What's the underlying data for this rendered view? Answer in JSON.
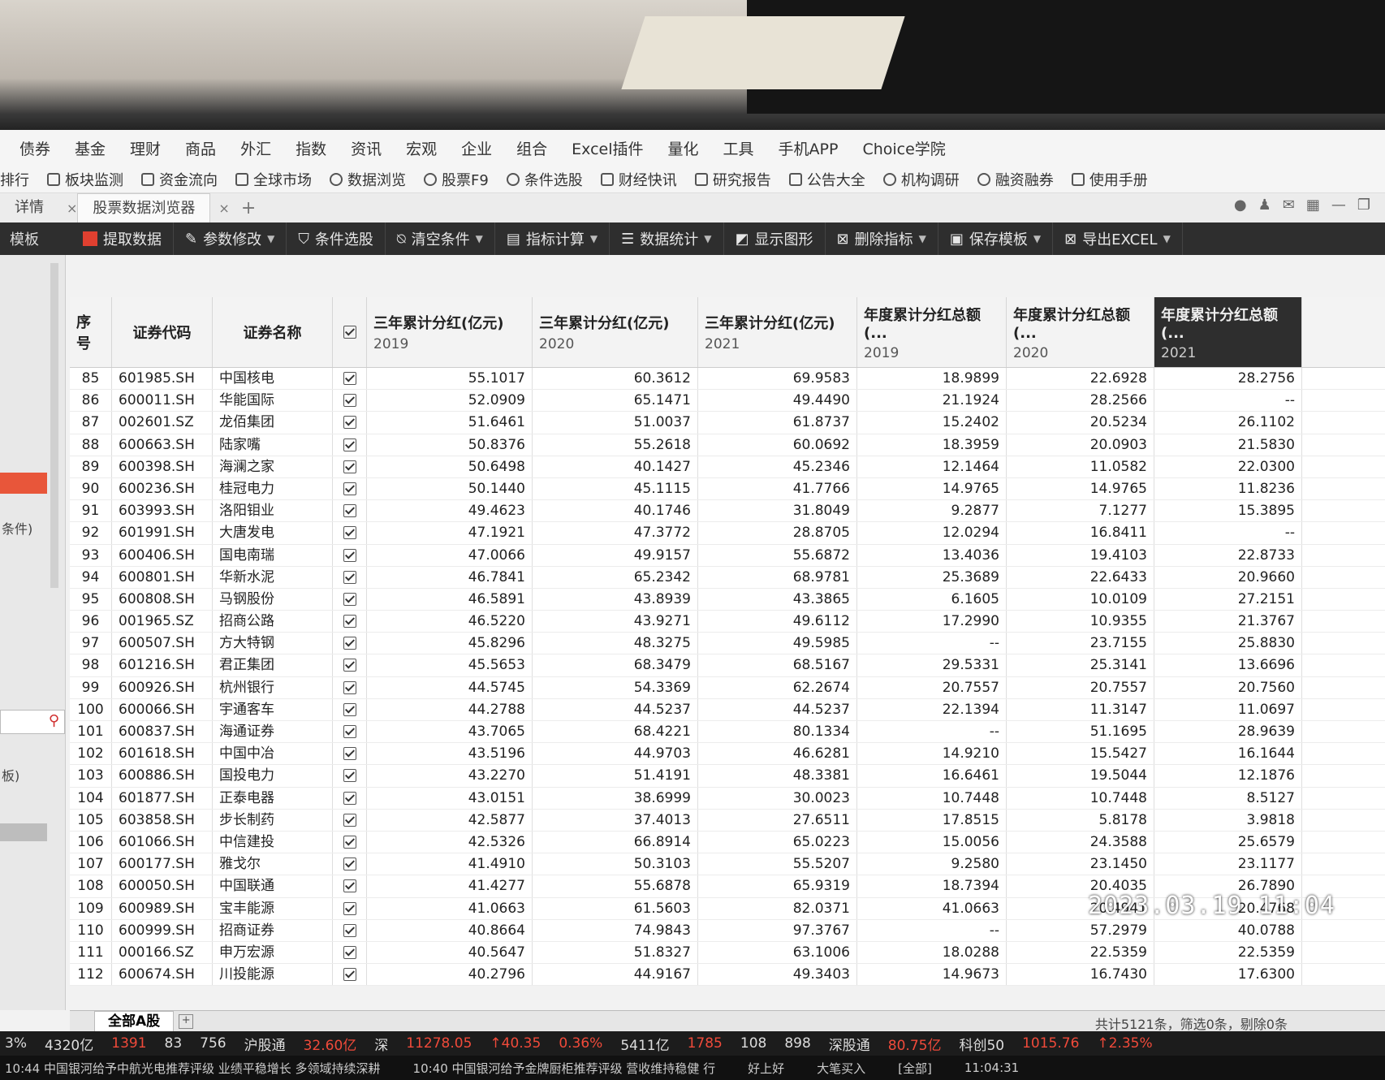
{
  "menu": [
    "债券",
    "基金",
    "理财",
    "商品",
    "外汇",
    "指数",
    "资讯",
    "宏观",
    "企业",
    "组合",
    "Excel插件",
    "量化",
    "工具",
    "手机APP",
    "Choice学院"
  ],
  "toolbar": [
    "排行",
    "板块监测",
    "资金流向",
    "全球市场",
    "数据浏览",
    "股票F9",
    "条件选股",
    "财经快讯",
    "研究报告",
    "公告大全",
    "机构调研",
    "融资融券",
    "使用手册"
  ],
  "tabs": {
    "left": "详情",
    "active": "股票数据浏览器"
  },
  "actions": {
    "left_label": "模板",
    "extract": "提取数据",
    "params": "参数修改",
    "filter": "条件选股",
    "clear": "清空条件",
    "calc": "指标计算",
    "stats": "数据统计",
    "chart": "显示图形",
    "delete": "删除指标",
    "save": "保存模板",
    "export": "导出EXCEL"
  },
  "sidebar": {
    "label1": "条件)",
    "label2": "板)"
  },
  "columns": {
    "seq": "序号",
    "code": "证券代码",
    "name": "证券名称",
    "c1": {
      "title": "三年累计分红(亿元)",
      "year": "2019"
    },
    "c2": {
      "title": "三年累计分红(亿元)",
      "year": "2020"
    },
    "c3": {
      "title": "三年累计分红(亿元)",
      "year": "2021"
    },
    "c4": {
      "title": "年度累计分红总额(...",
      "year": "2019"
    },
    "c5": {
      "title": "年度累计分红总额(...",
      "year": "2020"
    },
    "c6": {
      "title": "年度累计分红总额(...",
      "year": "2021"
    }
  },
  "rows": [
    [
      "85",
      "601985.SH",
      "中国核电",
      "55.1017",
      "60.3612",
      "69.9583",
      "18.9899",
      "22.6928",
      "28.2756"
    ],
    [
      "86",
      "600011.SH",
      "华能国际",
      "52.0909",
      "65.1471",
      "49.4490",
      "21.1924",
      "28.2566",
      "--"
    ],
    [
      "87",
      "002601.SZ",
      "龙佰集团",
      "51.6461",
      "51.0037",
      "61.8737",
      "15.2402",
      "20.5234",
      "26.1102"
    ],
    [
      "88",
      "600663.SH",
      "陆家嘴",
      "50.8376",
      "55.2618",
      "60.0692",
      "18.3959",
      "20.0903",
      "21.5830"
    ],
    [
      "89",
      "600398.SH",
      "海澜之家",
      "50.6498",
      "40.1427",
      "45.2346",
      "12.1464",
      "11.0582",
      "22.0300"
    ],
    [
      "90",
      "600236.SH",
      "桂冠电力",
      "50.1440",
      "45.1115",
      "41.7766",
      "14.9765",
      "14.9765",
      "11.8236"
    ],
    [
      "91",
      "603993.SH",
      "洛阳钼业",
      "49.4623",
      "40.1746",
      "31.8049",
      "9.2877",
      "7.1277",
      "15.3895"
    ],
    [
      "92",
      "601991.SH",
      "大唐发电",
      "47.1921",
      "47.3772",
      "28.8705",
      "12.0294",
      "16.8411",
      "--"
    ],
    [
      "93",
      "600406.SH",
      "国电南瑞",
      "47.0066",
      "49.9157",
      "55.6872",
      "13.4036",
      "19.4103",
      "22.8733"
    ],
    [
      "94",
      "600801.SH",
      "华新水泥",
      "46.7841",
      "65.2342",
      "68.9781",
      "25.3689",
      "22.6433",
      "20.9660"
    ],
    [
      "95",
      "600808.SH",
      "马钢股份",
      "46.5891",
      "43.8939",
      "43.3865",
      "6.1605",
      "10.0109",
      "27.2151"
    ],
    [
      "96",
      "001965.SZ",
      "招商公路",
      "46.5220",
      "43.9271",
      "49.6112",
      "17.2990",
      "10.9355",
      "21.3767"
    ],
    [
      "97",
      "600507.SH",
      "方大特钢",
      "45.8296",
      "48.3275",
      "49.5985",
      "--",
      "23.7155",
      "25.8830"
    ],
    [
      "98",
      "601216.SH",
      "君正集团",
      "45.5653",
      "68.3479",
      "68.5167",
      "29.5331",
      "25.3141",
      "13.6696"
    ],
    [
      "99",
      "600926.SH",
      "杭州银行",
      "44.5745",
      "54.3369",
      "62.2674",
      "20.7557",
      "20.7557",
      "20.7560"
    ],
    [
      "100",
      "600066.SH",
      "宇通客车",
      "44.2788",
      "44.5237",
      "44.5237",
      "22.1394",
      "11.3147",
      "11.0697"
    ],
    [
      "101",
      "600837.SH",
      "海通证券",
      "43.7065",
      "68.4221",
      "80.1334",
      "--",
      "51.1695",
      "28.9639"
    ],
    [
      "102",
      "601618.SH",
      "中国中冶",
      "43.5196",
      "44.9703",
      "46.6281",
      "14.9210",
      "15.5427",
      "16.1644"
    ],
    [
      "103",
      "600886.SH",
      "国投电力",
      "43.2270",
      "51.4191",
      "48.3381",
      "16.6461",
      "19.5044",
      "12.1876"
    ],
    [
      "104",
      "601877.SH",
      "正泰电器",
      "43.0151",
      "38.6999",
      "30.0023",
      "10.7448",
      "10.7448",
      "8.5127"
    ],
    [
      "105",
      "603858.SH",
      "步长制药",
      "42.5877",
      "37.4013",
      "27.6511",
      "17.8515",
      "5.8178",
      "3.9818"
    ],
    [
      "106",
      "601066.SH",
      "中信建投",
      "42.5326",
      "66.8914",
      "65.0223",
      "15.0056",
      "24.3588",
      "25.6579"
    ],
    [
      "107",
      "600177.SH",
      "雅戈尔",
      "41.4910",
      "50.3103",
      "55.5207",
      "9.2580",
      "23.1450",
      "23.1177"
    ],
    [
      "108",
      "600050.SH",
      "中国联通",
      "41.4277",
      "55.6878",
      "65.9319",
      "18.7394",
      "20.4035",
      "26.7890"
    ],
    [
      "109",
      "600989.SH",
      "宝丰能源",
      "41.0663",
      "61.5603",
      "82.0371",
      "41.0663",
      "20.4941",
      "20.4768"
    ],
    [
      "110",
      "600999.SH",
      "招商证券",
      "40.8664",
      "74.9843",
      "97.3767",
      "--",
      "57.2979",
      "40.0788"
    ],
    [
      "111",
      "000166.SZ",
      "申万宏源",
      "40.5647",
      "51.8327",
      "63.1006",
      "18.0288",
      "22.5359",
      "22.5359"
    ],
    [
      "112",
      "600674.SH",
      "川投能源",
      "40.2796",
      "44.9167",
      "49.3403",
      "14.9673",
      "16.7430",
      "17.6300"
    ]
  ],
  "sheet_tab": "全部A股",
  "totals": "共计5121条，筛选0条，剔除0条",
  "ticker": [
    "3%",
    "4320亿",
    "1391",
    "83",
    "756",
    "沪股通",
    "32.60亿",
    "深",
    "11278.05",
    "↑40.35",
    "0.36%",
    "5411亿",
    "1785",
    "108",
    "898",
    "深股通",
    "80.75亿",
    "科创50",
    "1015.76",
    "↑2.35%"
  ],
  "news": [
    "10:44 中国银河给予中航光电推荐评级 业绩平稳增长 多领域持续深耕",
    "10:40 中国银河给予金牌厨柜推荐评级 营收维持稳健 行",
    "好上好",
    "大笔买入",
    "[全部]",
    "11:04:31"
  ],
  "timestamp": "2023.03.19  11:04"
}
